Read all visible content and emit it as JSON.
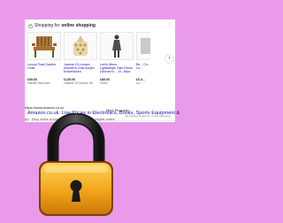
{
  "page": {
    "background": "#ea9aea"
  },
  "shopping": {
    "header_prefix": "Shopping for",
    "header_query": "online shopping",
    "more_menu": "⋮",
    "products": [
      {
        "name": "Luxury Teak Garden Chair",
        "price": "£69.00",
        "seller": "Garden Benches"
      },
      {
        "name": "Joanne Of London Women's Gold Acrylic Embellished",
        "price": "£125.00",
        "seller": "Joanne Of London UK"
      },
      {
        "name": "Levi's Mens Lightweight Skirt Dress (Women's ... M - Blue",
        "price": "£85.00",
        "seller": "Levi's"
      },
      {
        "name": "Be... Ch... Lu...",
        "price": "£0.4...",
        "seller": "Lu..."
      }
    ],
    "next_glyph": "›",
    "more_products_label": "More Products",
    "more_products_chev": "›",
    "sponsored_text": "Sponsored results for 'online shopping'"
  },
  "ad": {
    "url": "https://www.amazon.co.uk",
    "title": "Amazon.co.uk: Low Prices in Electronics, Books, Sports Equipment &",
    "description": "Ad · Shop online at Amazon. Free UK delivery on eligible orders."
  },
  "icons": {
    "lock": "padlock-icon",
    "bag": "shopping-bag-icon"
  },
  "colors": {
    "link": "#1a0dab",
    "lock_body": "#f2a51a",
    "lock_shackle": "#2b2b2b"
  }
}
